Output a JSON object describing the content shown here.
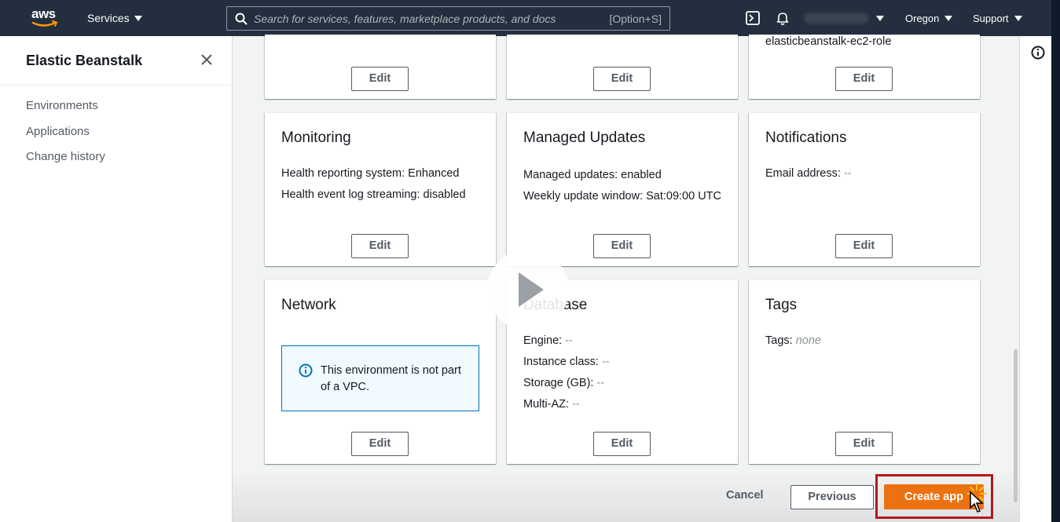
{
  "topnav": {
    "logo_text": "aws",
    "services_label": "Services",
    "search_placeholder": "Search for services, features, marketplace products, and docs",
    "search_shortcut": "[Option+S]",
    "region_label": "Oregon",
    "support_label": "Support",
    "icons": [
      "cloudshell-icon",
      "bell-icon"
    ]
  },
  "sidebar": {
    "title": "Elastic Beanstalk",
    "items": [
      {
        "label": "Environments"
      },
      {
        "label": "Applications"
      },
      {
        "label": "Change history"
      }
    ]
  },
  "cards_top": {
    "role_text": "elasticbeanstalk-ec2-role"
  },
  "cards": {
    "monitoring": {
      "title": "Monitoring",
      "line1": "Health reporting system: Enhanced",
      "line2": "Health event log streaming: disabled"
    },
    "managed_updates": {
      "title": "Managed Updates",
      "line1": "Managed updates: enabled",
      "line2": "Weekly update window: Sat:09:00 UTC"
    },
    "notifications": {
      "title": "Notifications",
      "email_label": "Email address:",
      "email_value": "--"
    },
    "network": {
      "title": "Network",
      "alert": "This environment is not part of a VPC."
    },
    "database": {
      "title": "Database",
      "engine_label": "Engine:",
      "engine_value": "--",
      "instance_label": "Instance class:",
      "instance_value": "--",
      "storage_label": "Storage (GB):",
      "storage_value": "--",
      "multiaz_label": "Multi-AZ:",
      "multiaz_value": "--"
    },
    "tags": {
      "title": "Tags",
      "tags_label": "Tags:",
      "tags_value": "none"
    }
  },
  "buttons": {
    "edit": "Edit",
    "cancel": "Cancel",
    "previous": "Previous",
    "create": "Create app"
  },
  "colors": {
    "nav_bg": "#232f3e",
    "primary": "#ec7211",
    "highlight": "#b3191a",
    "info_blue": "#0073bb"
  }
}
